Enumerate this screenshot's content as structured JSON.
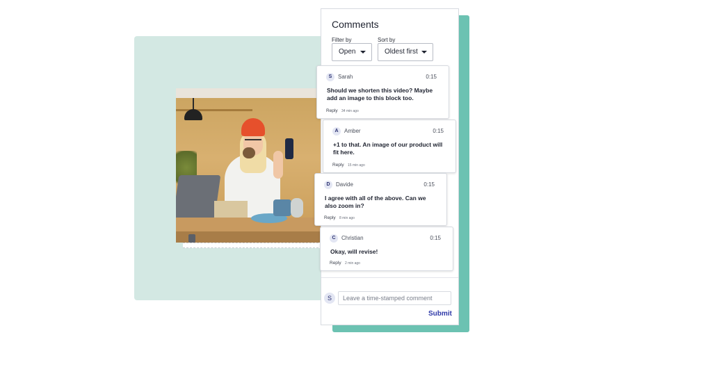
{
  "panel": {
    "title": "Comments",
    "filter_label": "Filter by",
    "filter_value": "Open",
    "sort_label": "Sort by",
    "sort_value": "Oldest first"
  },
  "comments": [
    {
      "initial": "S",
      "author": "Sarah",
      "time": "0:15",
      "text": "Should we shorten this video? Maybe add an image to this block too.",
      "reply": "Reply",
      "ago": "34 min ago"
    },
    {
      "initial": "A",
      "author": "Amber",
      "time": "0:15",
      "text": "+1 to that. An image of our product will fit here.",
      "reply": "Reply",
      "ago": "15 min ago"
    },
    {
      "initial": "D",
      "author": "Davide",
      "time": "0:15",
      "text": "I agree with all of the above. Can we also zoom in?",
      "reply": "Reply",
      "ago": "8 min ago"
    },
    {
      "initial": "C",
      "author": "Christian",
      "time": "0:15",
      "text": "Okay, will revise!",
      "reply": "Reply",
      "ago": "2 min ago"
    }
  ],
  "composer": {
    "avatar_initial": "S",
    "placeholder": "Leave a time-stamped comment",
    "submit_label": "Submit"
  },
  "colors": {
    "accent": "#2f3aa8",
    "mint_background": "#d3e8e3",
    "teal_shadow": "#6cc2b2"
  }
}
